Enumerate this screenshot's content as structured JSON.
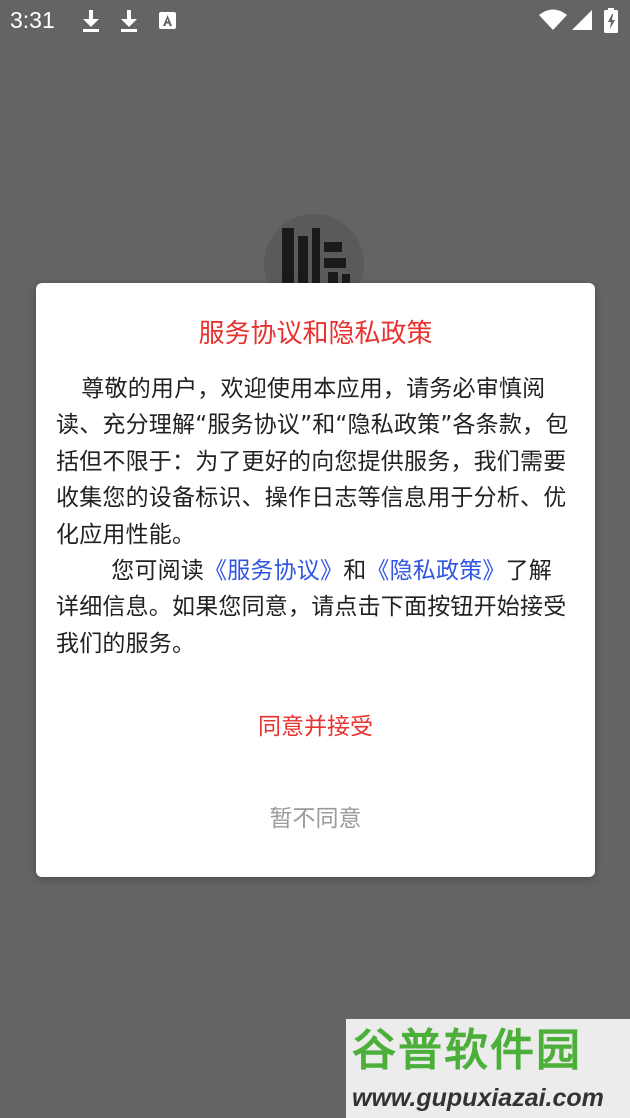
{
  "status_bar": {
    "time": "3:31",
    "icons": [
      "download-icon",
      "download-icon",
      "a-icon",
      "wifi-icon",
      "signal-icon",
      "battery-icon"
    ]
  },
  "background": {
    "logo_icon": "app-logo"
  },
  "dialog": {
    "title": "服务协议和隐私政策",
    "paragraph1": "尊敬的用户，欢迎使用本应用，请务必审慎阅读、充分理解“服务协议”和“隐私政策”各条款，包括但不限于：为了更好的向您提供服务，我们需要收集您的设备标识、操作日志等信息用于分析、优化应用性能。",
    "paragraph2_prefix": "您可阅读",
    "service_link": "《服务协议》",
    "paragraph2_and": "和",
    "privacy_link": "《隐私政策》",
    "paragraph2_suffix": "了解详细信息。如果您同意，请点击下面按钮开始接受我们的服务。",
    "agree_label": "同意并接受",
    "disagree_label": "暂不同意"
  },
  "watermark": {
    "logo_text": "谷普软件园",
    "url": "www.gupuxiazai.com"
  },
  "colors": {
    "accent_red": "#e8322f",
    "link_blue": "#2f55e3",
    "muted_gray": "#9a9a9a",
    "overlay": "#646464",
    "watermark_green": "#4caf3a"
  }
}
